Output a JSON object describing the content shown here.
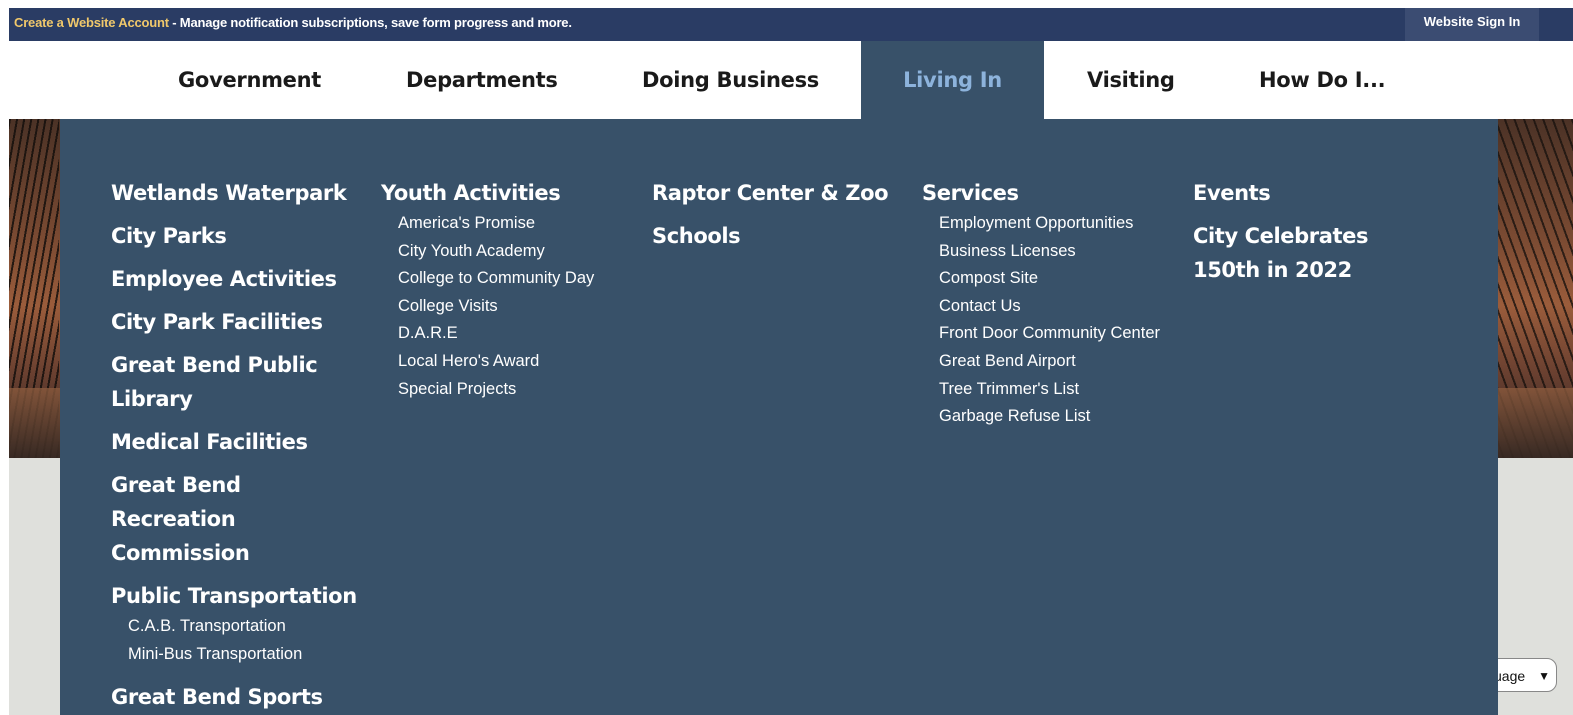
{
  "topbar": {
    "create_account_link": "Create a Website Account",
    "notice_text": " - Manage notification subscriptions, save form progress and more.",
    "signin_label": "Website Sign In"
  },
  "nav": {
    "items": [
      {
        "label": "Government"
      },
      {
        "label": "Departments"
      },
      {
        "label": "Doing Business"
      },
      {
        "label": "Living In"
      },
      {
        "label": "Visiting"
      },
      {
        "label": "How Do I..."
      }
    ],
    "active": "Living In"
  },
  "menu": {
    "col1": {
      "items": [
        "Wetlands Waterpark",
        "City Parks",
        "Employee Activities",
        "City Park Facilities",
        "Great Bend Public Library",
        "Medical Facilities",
        "Great Bend Recreation Commission",
        "Public Transportation",
        "Great Bend Sports Complex"
      ],
      "public_transportation_sub": [
        "C.A.B. Transportation",
        "Mini-Bus Transportation"
      ]
    },
    "col2": {
      "heading": "Youth Activities",
      "sub": [
        "America's Promise",
        "City Youth Academy",
        "College to Community Day",
        "College Visits",
        "D.A.R.E",
        "Local Hero's Award",
        "Special Projects"
      ]
    },
    "col3": {
      "items": [
        "Raptor Center & Zoo",
        "Schools"
      ]
    },
    "col4": {
      "heading": "Services",
      "sub": [
        "Employment Opportunities",
        "Business Licenses",
        "Compost Site",
        "Contact Us",
        "Front Door Community Center",
        "Great Bend Airport",
        "Tree Trimmer's List",
        "Garbage Refuse List"
      ]
    },
    "col5": {
      "items": [
        "Events",
        "City Celebrates 150th in 2022"
      ]
    }
  },
  "language_select": {
    "visible_text": "uage"
  },
  "colors": {
    "topbar": "#2a3c64",
    "menu_bg": "#385169",
    "active_nav_text": "#8db3dc",
    "link_gold": "#f0c86b"
  }
}
